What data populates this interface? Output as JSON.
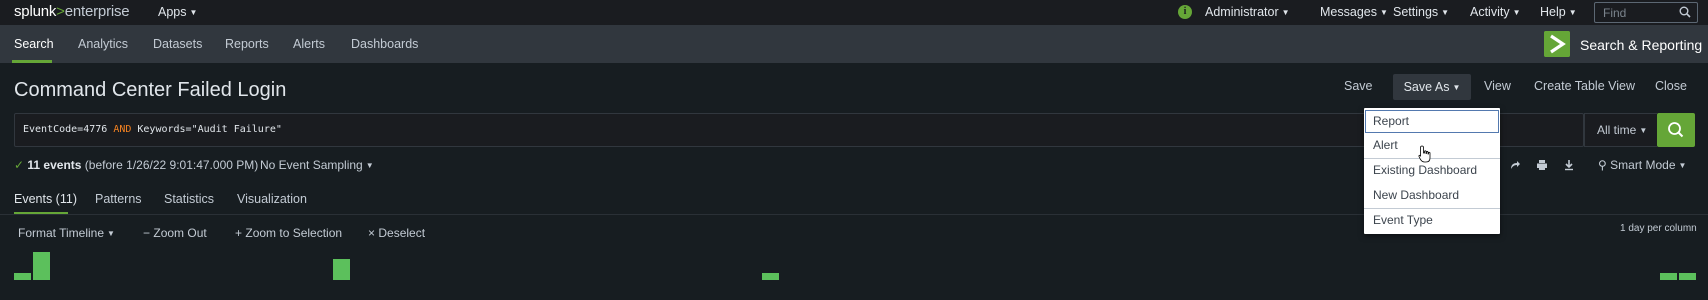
{
  "topbar": {
    "logo_main": "splunk",
    "logo_sep": ">",
    "logo_sub": "enterprise",
    "apps_label": "Apps",
    "info_icon": "info-icon",
    "user_label": "Administrator",
    "messages_label": "Messages",
    "settings_label": "Settings",
    "activity_label": "Activity",
    "help_label": "Help",
    "find_placeholder": "Find"
  },
  "nav": {
    "items": [
      "Search",
      "Analytics",
      "Datasets",
      "Reports",
      "Alerts",
      "Dashboards"
    ],
    "active": "Search",
    "app_name": "Search & Reporting"
  },
  "title_row": {
    "title": "Command Center Failed Login",
    "save": "Save",
    "save_as": "Save As",
    "view": "View",
    "create_table_view": "Create Table View",
    "close": "Close"
  },
  "search": {
    "query_part1": "EventCode=4776 ",
    "query_keyword": "AND",
    "query_part2": " Keywords=\"Audit Failure\"",
    "time_range": "All time"
  },
  "status": {
    "events_count": "11 events",
    "events_detail": "(before 1/26/22 9:01:47.000 PM)",
    "sampling": "No Event Sampling",
    "mode": "Smart Mode"
  },
  "tabs": [
    "Events (11)",
    "Patterns",
    "Statistics",
    "Visualization"
  ],
  "timeline": {
    "format": "Format Timeline",
    "zoom_out": "Zoom Out",
    "zoom_selection": "Zoom to Selection",
    "deselect": "Deselect",
    "scale": "1 day per column",
    "bar_color": "#5cc05c",
    "columns": [
      {
        "day_index": 0,
        "count": 1
      },
      {
        "day_index": 1,
        "count": 4
      },
      {
        "day_index": 2,
        "count": 3
      },
      {
        "day_index": 3,
        "count": 1
      },
      {
        "day_index": 4,
        "count": 1
      },
      {
        "day_index": 5,
        "count": 1
      }
    ]
  },
  "save_as_menu": {
    "items": [
      "Report",
      "Alert",
      "Existing Dashboard",
      "New Dashboard",
      "Event Type"
    ]
  },
  "colors": {
    "accent": "#65a637",
    "keyword": "#f58220"
  }
}
